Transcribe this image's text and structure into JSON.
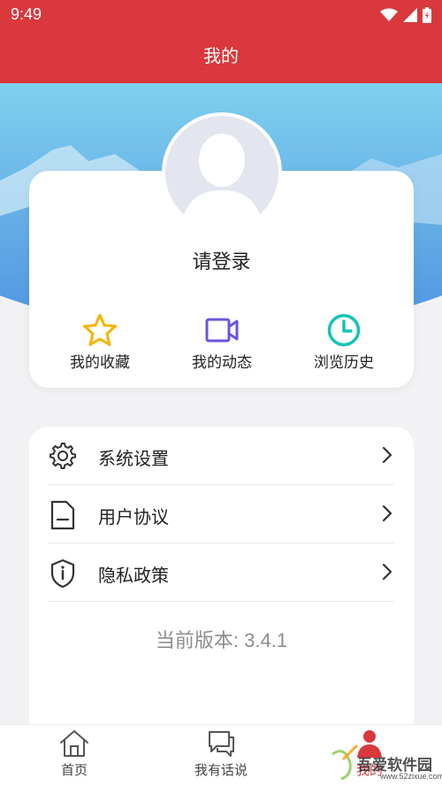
{
  "status_bar": {
    "time": "9:49"
  },
  "header": {
    "title": "我的"
  },
  "profile": {
    "login_prompt": "请登录"
  },
  "quick_actions": [
    {
      "label": "我的收藏",
      "icon": "star-icon",
      "color": "#f5b400"
    },
    {
      "label": "我的动态",
      "icon": "video-icon",
      "color": "#6a55e0"
    },
    {
      "label": "浏览历史",
      "icon": "clock-icon",
      "color": "#14c4b4"
    }
  ],
  "menu": {
    "items": [
      {
        "label": "系统设置",
        "icon": "gear-icon"
      },
      {
        "label": "用户协议",
        "icon": "document-icon"
      },
      {
        "label": "隐私政策",
        "icon": "shield-icon"
      }
    ],
    "version": "当前版本: 3.4.1"
  },
  "tabs": [
    {
      "label": "首页",
      "icon": "home-icon"
    },
    {
      "label": "我有话说",
      "icon": "chat-icon"
    },
    {
      "label": "我的",
      "icon": "person-icon",
      "active": true
    }
  ],
  "watermark": {
    "text": "吾爱软件园",
    "url": "www.52zixue.com"
  },
  "colors": {
    "primary": "#d9383d",
    "hero_top": "#7fd0ee",
    "hero_bottom": "#4a8fe0"
  }
}
